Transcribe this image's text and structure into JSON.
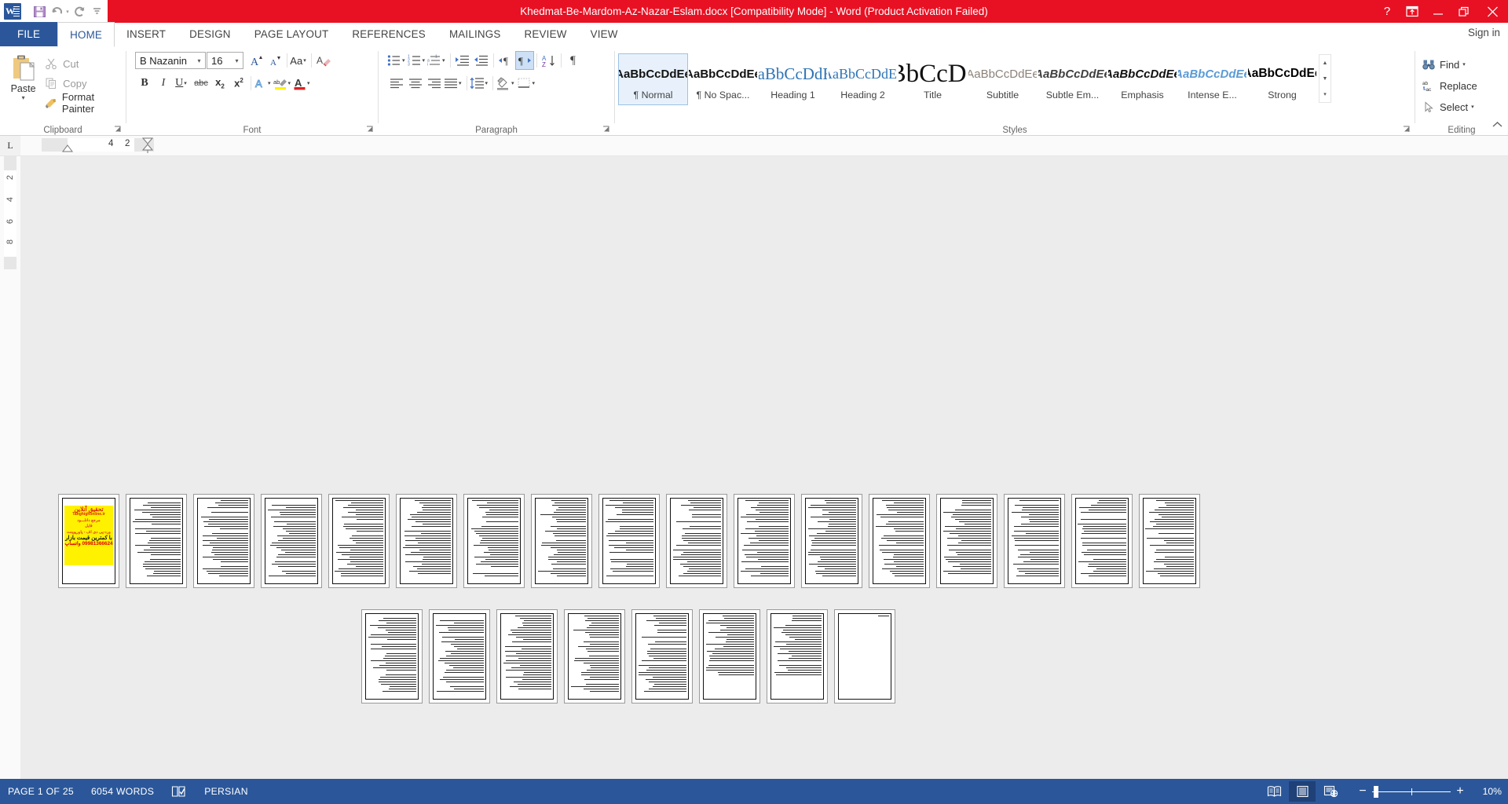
{
  "titlebar": {
    "document_title": "Khedmat-Be-Mardom-Az-Nazar-Eslam.docx [Compatibility Mode]  -  Word (Product Activation Failed)",
    "quick_access": [
      {
        "name": "save-icon",
        "label": "Save"
      },
      {
        "name": "undo-icon",
        "label": "Undo"
      },
      {
        "name": "redo-icon",
        "label": "Repeat"
      },
      {
        "name": "customize-qat-icon",
        "label": "Customize Quick Access Toolbar"
      }
    ],
    "window_controls": [
      {
        "name": "help-icon",
        "glyph": "?"
      },
      {
        "name": "ribbon-display-options-icon",
        "glyph": ""
      },
      {
        "name": "minimize-icon",
        "glyph": ""
      },
      {
        "name": "restore-icon",
        "glyph": ""
      },
      {
        "name": "close-icon",
        "glyph": ""
      }
    ]
  },
  "tabs": {
    "file_label": "FILE",
    "items": [
      "HOME",
      "INSERT",
      "DESIGN",
      "PAGE LAYOUT",
      "REFERENCES",
      "MAILINGS",
      "REVIEW",
      "VIEW"
    ],
    "active": "HOME",
    "sign_in": "Sign in"
  },
  "ribbon": {
    "clipboard": {
      "group_label": "Clipboard",
      "paste_label": "Paste",
      "cut_label": "Cut",
      "copy_label": "Copy",
      "format_painter_label": "Format Painter"
    },
    "font": {
      "group_label": "Font",
      "font_family_value": "B Nazanin",
      "font_size_value": "16",
      "buttons": [
        {
          "name": "grow-font-button",
          "glyph": "A"
        },
        {
          "name": "shrink-font-button",
          "glyph": "A"
        },
        {
          "name": "change-case-button",
          "glyph": "Aa"
        },
        {
          "name": "clear-formatting-button",
          "glyph": "A"
        },
        {
          "name": "bold-button",
          "glyph": "B"
        },
        {
          "name": "italic-button",
          "glyph": "I"
        },
        {
          "name": "underline-button",
          "glyph": "U"
        },
        {
          "name": "strikethrough-button",
          "glyph": "abc"
        },
        {
          "name": "subscript-button",
          "glyph": "x2"
        },
        {
          "name": "superscript-button",
          "glyph": "x2"
        },
        {
          "name": "text-effects-button",
          "glyph": "A"
        },
        {
          "name": "text-highlight-color-button",
          "glyph": "ab"
        },
        {
          "name": "font-color-button",
          "glyph": "A"
        }
      ]
    },
    "paragraph": {
      "group_label": "Paragraph",
      "buttons": [
        {
          "name": "bullets-button"
        },
        {
          "name": "numbering-button"
        },
        {
          "name": "multilevel-list-button"
        },
        {
          "name": "increase-indent-button"
        },
        {
          "name": "decrease-indent-button"
        },
        {
          "name": "ltr-text-direction-button"
        },
        {
          "name": "rtl-text-direction-button"
        },
        {
          "name": "sort-button"
        },
        {
          "name": "show-formatting-marks-button"
        },
        {
          "name": "align-left-button"
        },
        {
          "name": "align-center-button"
        },
        {
          "name": "align-right-button"
        },
        {
          "name": "justify-button"
        },
        {
          "name": "line-spacing-button"
        },
        {
          "name": "shading-button"
        },
        {
          "name": "borders-button"
        }
      ],
      "rtl_selected": true
    },
    "styles": {
      "group_label": "Styles",
      "items": [
        {
          "preview": "bCcDdEe",
          "name": "¶ Normal",
          "selected": true,
          "style": "normal"
        },
        {
          "preview": "bCcDdEe",
          "name": "¶ No Spac...",
          "selected": false,
          "style": "normal"
        },
        {
          "preview": "DdEe",
          "name": "Heading 1",
          "selected": false,
          "style": "h1"
        },
        {
          "preview": "cCcDdEe",
          "name": "Heading 2",
          "selected": false,
          "style": "h2"
        },
        {
          "preview": "dEe",
          "name": "Title",
          "selected": false,
          "style": "title"
        },
        {
          "preview": "CcDdEe",
          "name": "Subtitle",
          "selected": false,
          "style": "subtitle"
        },
        {
          "preview": "bCcDdEe",
          "name": "Subtle Em...",
          "selected": false,
          "style": "subtle-em"
        },
        {
          "preview": "bCcDdEe",
          "name": "Emphasis",
          "selected": false,
          "style": "emphasis"
        },
        {
          "preview": "bCcDdEe",
          "name": "Intense E...",
          "selected": false,
          "style": "intense-em"
        },
        {
          "preview": "bCcDdEe",
          "name": "Strong",
          "selected": false,
          "style": "strong"
        }
      ]
    },
    "editing": {
      "group_label": "Editing",
      "find_label": "Find",
      "replace_label": "Replace",
      "select_label": "Select"
    }
  },
  "ruler": {
    "tab_stop_marker": "L",
    "horizontal_marks": [
      "4",
      "2"
    ],
    "vertical_marks": [
      "2",
      "4",
      "6",
      "8"
    ]
  },
  "document": {
    "page_count_row1": 17,
    "page_count_row2": 8,
    "ad_lines": [
      "تحقیق آنلاین",
      "Tahghighonline.ir",
      "مرجع دانلـــود",
      "فایل",
      "ورد-پی دی اف - پاورپوینت",
      "با کمترین قیمت بازار",
      "09981366624 واتساپ"
    ]
  },
  "statusbar": {
    "page_info": "PAGE 1 OF 25",
    "word_count": "6054 WORDS",
    "proofing_icon": "proofing-errors-icon",
    "language": "PERSIAN",
    "views": [
      {
        "name": "read-mode-button",
        "active": false
      },
      {
        "name": "print-layout-button",
        "active": true
      },
      {
        "name": "web-layout-button",
        "active": false
      }
    ],
    "zoom_out_label": "−",
    "zoom_in_label": "+",
    "zoom_level": "10%"
  },
  "colors": {
    "title_red": "#E81123",
    "word_blue": "#2B579A",
    "status_blue": "#2B579A",
    "ad_yellow": "#FFF200",
    "selection_blue": "#CDE0F5"
  }
}
